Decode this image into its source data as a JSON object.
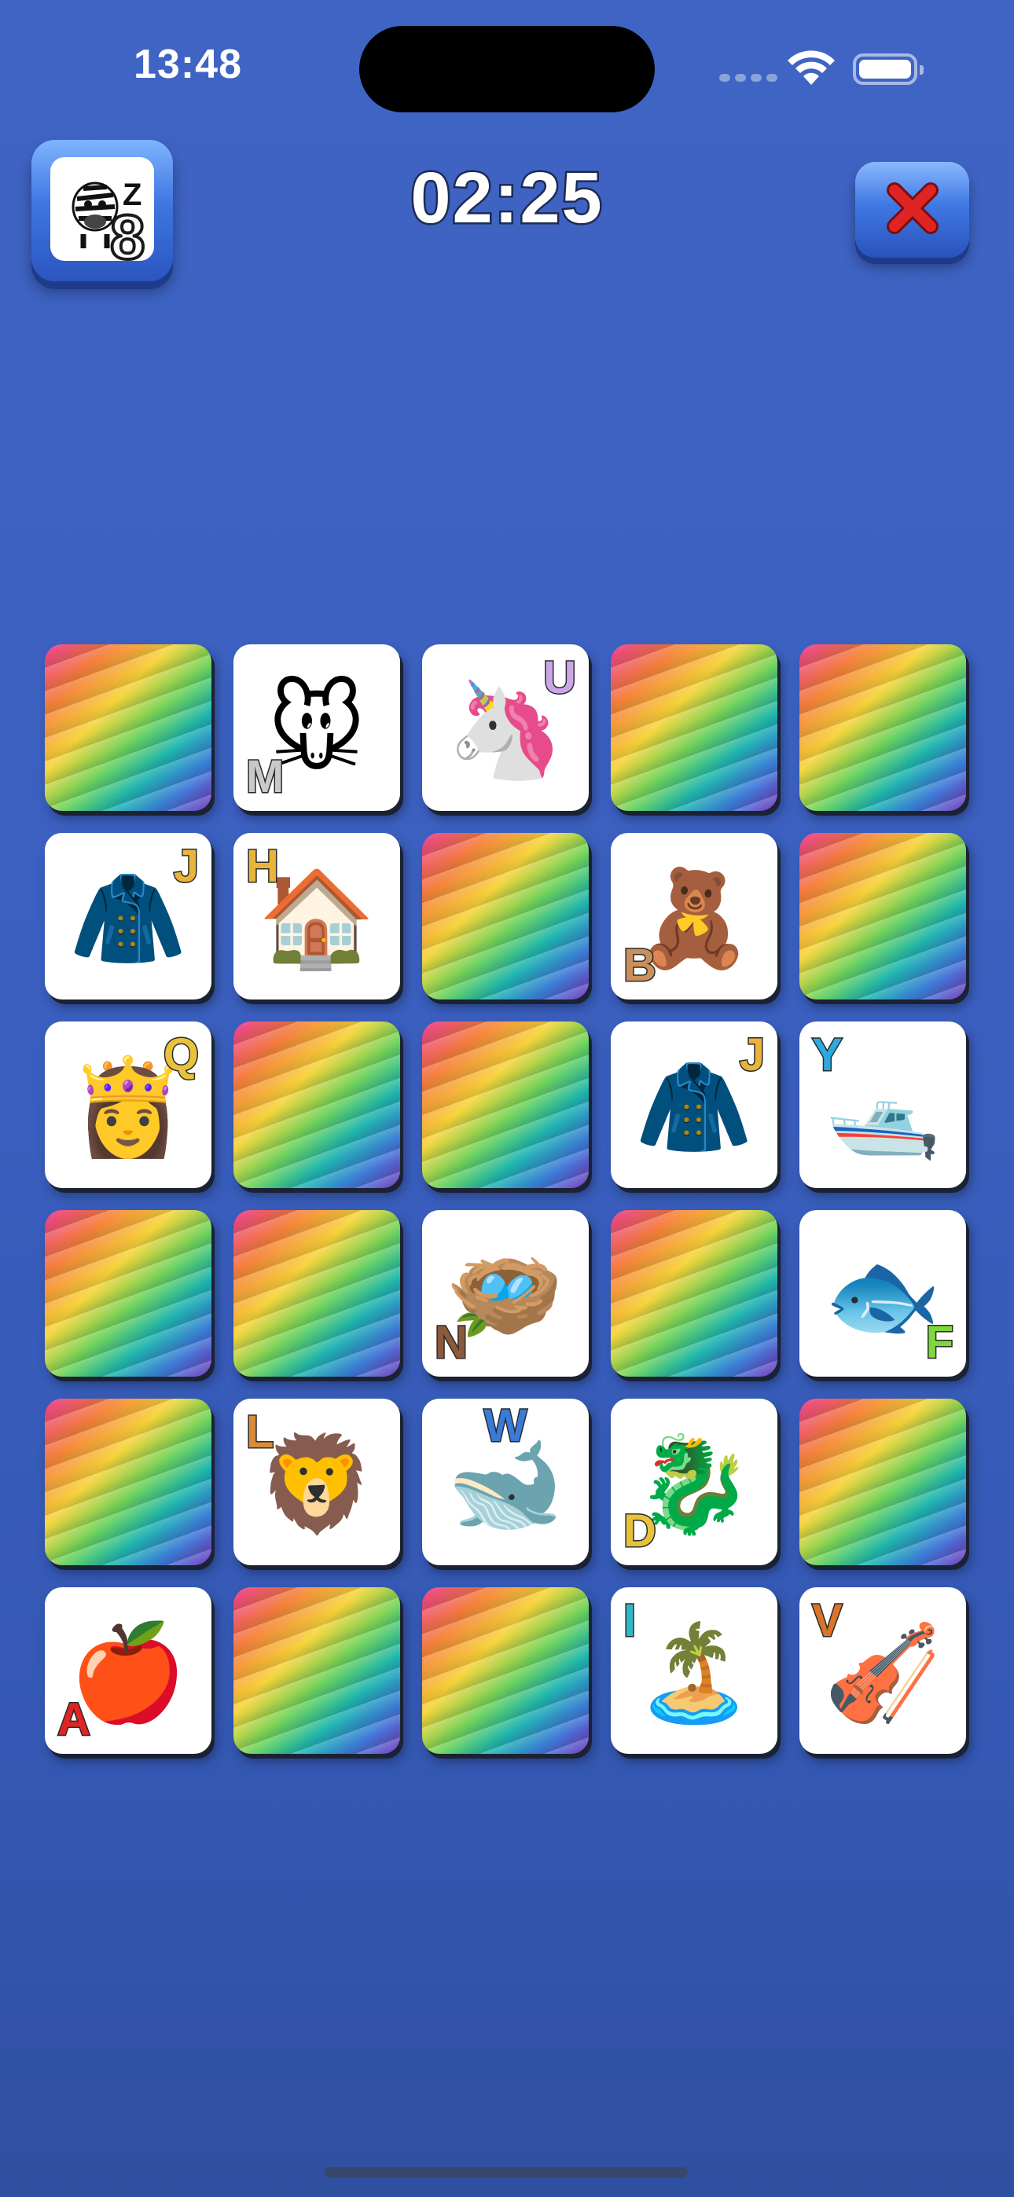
{
  "status_bar": {
    "time": "13:48"
  },
  "header": {
    "level_letter": "Z",
    "level_number": "8",
    "timer": "02:25",
    "level_icon": "zebra-icon",
    "close_icon": "close-icon"
  },
  "colors": {
    "background": "#3a5fbf",
    "button_blue": "#3f76e0",
    "close_red": "#e02424"
  },
  "cards": [
    {
      "state": "hidden"
    },
    {
      "state": "revealed",
      "letter": "M",
      "subject": "mouse",
      "icon": "mouse-icon",
      "glyph": "🐭",
      "letter_pos": "bl",
      "letter_color": "#c9c9c9"
    },
    {
      "state": "revealed",
      "letter": "U",
      "subject": "unicorn",
      "icon": "unicorn-icon",
      "glyph": "🦄",
      "letter_pos": "tr",
      "letter_color": "#c9a6e8"
    },
    {
      "state": "hidden"
    },
    {
      "state": "hidden"
    },
    {
      "state": "revealed",
      "letter": "J",
      "subject": "jacket",
      "icon": "jacket-icon",
      "glyph": "🧥",
      "letter_pos": "tr",
      "letter_color": "#e8b43a"
    },
    {
      "state": "revealed",
      "letter": "H",
      "subject": "house",
      "icon": "house-icon",
      "glyph": "🏠",
      "letter_pos": "tl",
      "letter_color": "#e8b43a"
    },
    {
      "state": "hidden"
    },
    {
      "state": "revealed",
      "letter": "B",
      "subject": "bear",
      "icon": "bear-icon",
      "glyph": "🧸",
      "letter_pos": "bl",
      "letter_color": "#c8905a"
    },
    {
      "state": "hidden"
    },
    {
      "state": "revealed",
      "letter": "Q",
      "subject": "queen",
      "icon": "queen-icon",
      "glyph": "👸",
      "letter_pos": "tr",
      "letter_color": "#e8c23a"
    },
    {
      "state": "hidden"
    },
    {
      "state": "hidden"
    },
    {
      "state": "revealed",
      "letter": "J",
      "subject": "jacket",
      "icon": "jacket-icon",
      "glyph": "🧥",
      "letter_pos": "tr",
      "letter_color": "#e8b43a"
    },
    {
      "state": "revealed",
      "letter": "Y",
      "subject": "yacht",
      "icon": "yacht-icon",
      "glyph": "🛥️",
      "letter_pos": "tl",
      "letter_color": "#2fa8e0"
    },
    {
      "state": "hidden"
    },
    {
      "state": "hidden"
    },
    {
      "state": "revealed",
      "letter": "N",
      "subject": "nest",
      "icon": "nest-icon",
      "glyph": "🪺",
      "letter_pos": "bl",
      "letter_color": "#8a5a3a"
    },
    {
      "state": "hidden"
    },
    {
      "state": "revealed",
      "letter": "F",
      "subject": "fish",
      "icon": "fish-icon",
      "glyph": "🐟",
      "letter_pos": "br",
      "letter_color": "#7ed83a"
    },
    {
      "state": "hidden"
    },
    {
      "state": "revealed",
      "letter": "L",
      "subject": "lion",
      "icon": "lion-icon",
      "glyph": "🦁",
      "letter_pos": "tl",
      "letter_color": "#d98a3a"
    },
    {
      "state": "revealed",
      "letter": "W",
      "subject": "whale",
      "icon": "whale-icon",
      "glyph": "🐋",
      "letter_pos": "tc",
      "letter_color": "#3a7bd9"
    },
    {
      "state": "revealed",
      "letter": "D",
      "subject": "dragon",
      "icon": "dragon-icon",
      "glyph": "🐉",
      "letter_pos": "bl",
      "letter_color": "#e8c23a"
    },
    {
      "state": "hidden"
    },
    {
      "state": "revealed",
      "letter": "A",
      "subject": "apple",
      "icon": "apple-icon",
      "glyph": "🍎",
      "letter_pos": "bl",
      "letter_color": "#e02424"
    },
    {
      "state": "hidden"
    },
    {
      "state": "hidden"
    },
    {
      "state": "revealed",
      "letter": "I",
      "subject": "island",
      "icon": "island-icon",
      "glyph": "🏝️",
      "letter_pos": "tl",
      "letter_color": "#2fb8c8"
    },
    {
      "state": "revealed",
      "letter": "V",
      "subject": "violin",
      "icon": "violin-icon",
      "glyph": "🎻",
      "letter_pos": "tl",
      "letter_color": "#d9742a"
    }
  ]
}
